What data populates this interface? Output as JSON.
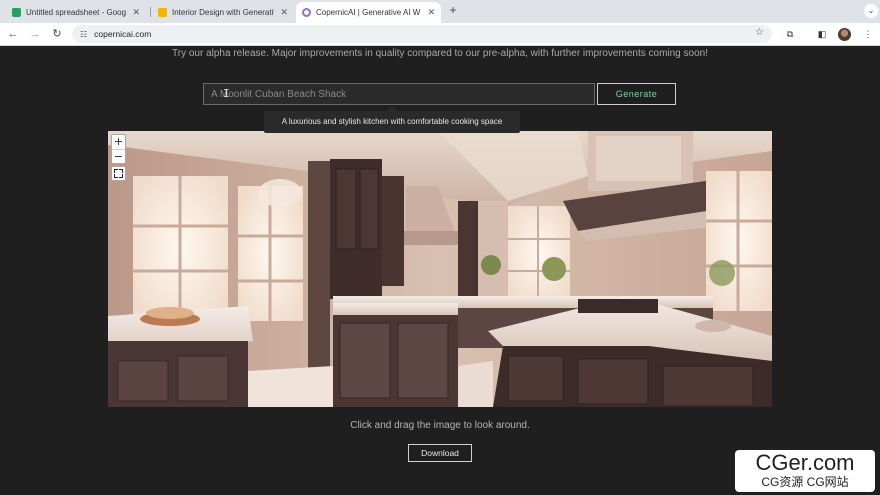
{
  "browser": {
    "tabs": [
      {
        "title": "Untitled spreadsheet - Googl",
        "favicon_color": "#1ea362",
        "active": false
      },
      {
        "title": "Interior Design with Generativ",
        "favicon_color": "#f4b400",
        "active": false
      },
      {
        "title": "CopernicAI | Generative AI W",
        "favicon_color": "#8e6ed8",
        "active": true
      }
    ],
    "new_tab_label": "+",
    "url": "copernicai.com"
  },
  "page": {
    "subtitle": "Try our alpha release. Major improvements in quality compared to our pre-alpha, with further improvements coming soon!",
    "prompt": {
      "placeholder": "A Moonlit Cuban Beach Shack",
      "value": ""
    },
    "generate_label": "Generate",
    "tooltip": "A luxurious and stylish kitchen with comfortable cooking space",
    "viewer": {
      "zoom_in_label": "+",
      "zoom_out_label": "−"
    },
    "hint": "Click and drag the image to look around.",
    "download_label": "Download"
  },
  "watermark": {
    "main": "CGer.com",
    "sub": "CG资源 CG网站"
  },
  "colors": {
    "page_bg": "#1f1f1f",
    "generate_text": "#79d3a5"
  }
}
